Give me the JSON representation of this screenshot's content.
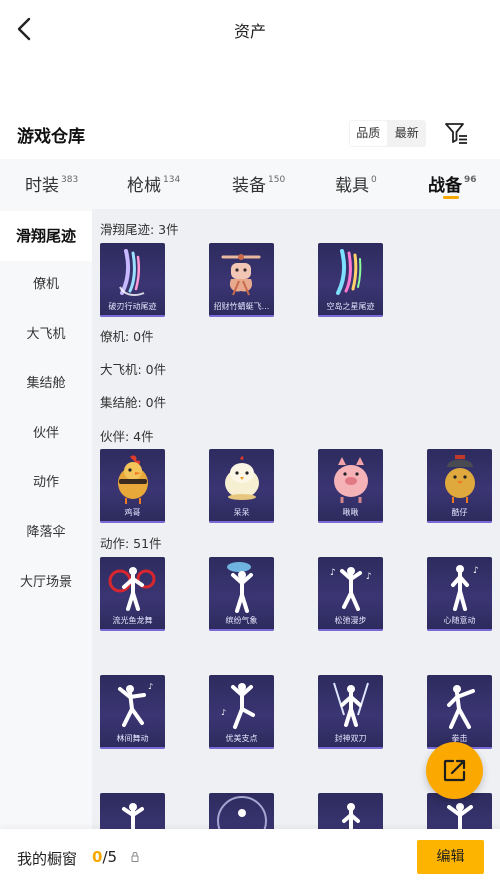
{
  "header": {
    "title": "资产",
    "back_icon": "chevron-left-icon"
  },
  "warehouse": {
    "title": "游戏仓库",
    "sort_options": [
      {
        "label": "品质",
        "active": true
      },
      {
        "label": "最新",
        "active": false
      }
    ],
    "filter_icon": "filter-icon"
  },
  "tabs": [
    {
      "label": "时装",
      "count": "383",
      "active": false
    },
    {
      "label": "枪械",
      "count": "134",
      "active": false
    },
    {
      "label": "装备",
      "count": "150",
      "active": false
    },
    {
      "label": "载具",
      "count": "0",
      "active": false
    },
    {
      "label": "战备",
      "count": "96",
      "active": true
    }
  ],
  "sidebar": {
    "items": [
      {
        "label": "滑翔尾迹",
        "active": true
      },
      {
        "label": "僚机",
        "active": false
      },
      {
        "label": "大飞机",
        "active": false
      },
      {
        "label": "集结舱",
        "active": false
      },
      {
        "label": "伙伴",
        "active": false
      },
      {
        "label": "动作",
        "active": false
      },
      {
        "label": "降落伞",
        "active": false
      },
      {
        "label": "大厅场景",
        "active": false
      }
    ]
  },
  "sections": {
    "glide_trail": {
      "label": "滑翔尾迹: 3件",
      "items": [
        "破刃行动尾迹",
        "招财竹蜻蜓飞...",
        "空岛之星尾迹"
      ]
    },
    "wingman": {
      "label": "僚机: 0件"
    },
    "big_plane": {
      "label": "大飞机: 0件"
    },
    "assembly_pod": {
      "label": "集结舱: 0件"
    },
    "partner": {
      "label": "伙伴: 4件",
      "items": [
        "鸡哥",
        "呆呆",
        "啾啾",
        "酷仔"
      ]
    },
    "emote": {
      "label": "动作: 51件",
      "items": [
        "流光鱼龙舞",
        "缤纷气象",
        "松弛漫步",
        "心随意动",
        "林间舞动",
        "优美支点",
        "封神双刀",
        "拳击"
      ]
    }
  },
  "fab": {
    "icon": "share-icon"
  },
  "showcase": {
    "label": "我的橱窗",
    "current": "0",
    "separator": "/",
    "max": "5",
    "lock_icon": "lock-icon",
    "edit_label": "编辑"
  },
  "colors": {
    "accent": "#f5a800",
    "card_bg": "#342f6a",
    "sidebar_bg": "#f7f8fa",
    "content_bg": "#eef0f3"
  }
}
